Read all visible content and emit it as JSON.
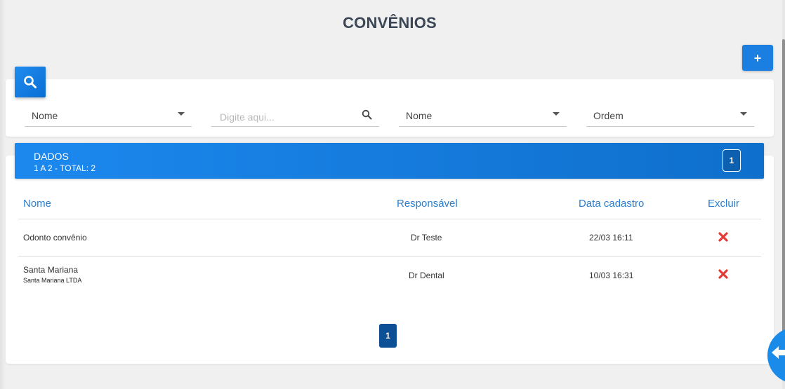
{
  "page": {
    "title": "CONVÊNIOS"
  },
  "toolbar": {
    "add_label": "+"
  },
  "filters": {
    "field1": "Nome",
    "search_placeholder": "Digite aqui...",
    "field2": "Nome",
    "order": "Ordem"
  },
  "data": {
    "title": "DADOS",
    "summary": "1 A 2 - TOTAL: 2",
    "page_badge": "1"
  },
  "table": {
    "headers": [
      "Nome",
      "Responsável",
      "Data cadastro",
      "Excluir"
    ],
    "rows": [
      {
        "name": "Odonto convênio",
        "subtitle": "",
        "responsavel": "Dr Teste",
        "data": "22/03 16:11"
      },
      {
        "name": "Santa Mariana",
        "subtitle": "Santa Mariana LTDA",
        "responsavel": "Dr Dental",
        "data": "10/03 16:31"
      }
    ]
  },
  "pagination": {
    "current": "1"
  },
  "colors": {
    "accent": "#1a7fe0",
    "delete": "#e53935",
    "header_text": "#2a7fcf"
  },
  "icons": [
    "search-icon",
    "plus-icon",
    "dropdown-caret-icon",
    "delete-x-icon",
    "back-arrow-icon"
  ]
}
